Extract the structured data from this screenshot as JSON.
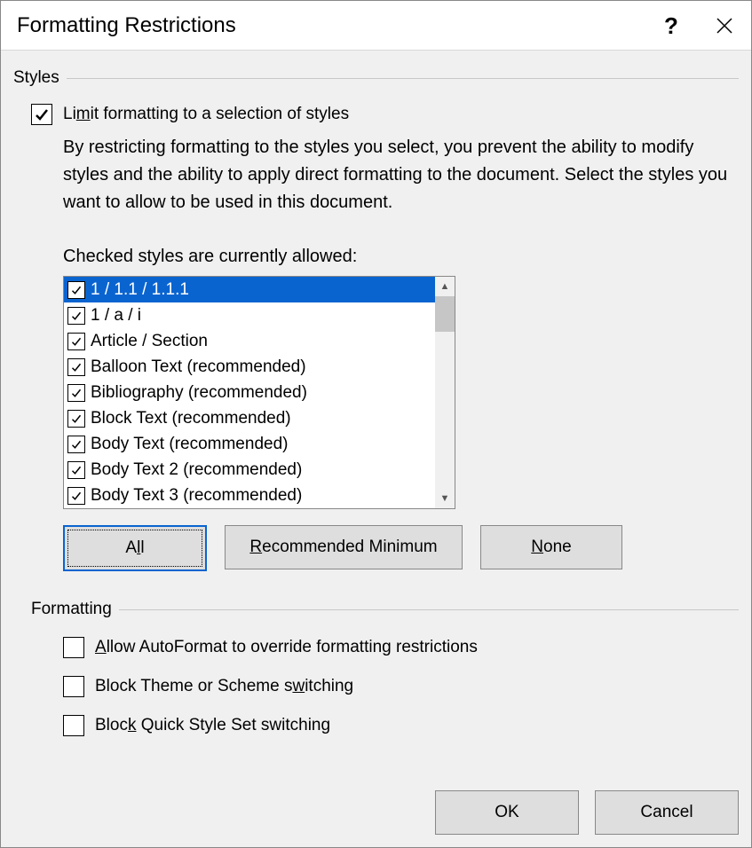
{
  "title": "Formatting Restrictions",
  "styles_section_label": "Styles",
  "limit_checkbox": {
    "label_pre": "Li",
    "label_u": "m",
    "label_post": "it formatting to a selection of styles",
    "checked": true
  },
  "description": "By restricting formatting to the styles you select, you prevent the ability to modify styles and the ability to apply direct formatting to the document. Select the styles you want to allow to be used in this document.",
  "list_header": "Checked styles are currently allowed:",
  "styles_list": [
    {
      "label": "1 / 1.1 / 1.1.1",
      "checked": true,
      "selected": true
    },
    {
      "label": "1 / a / i",
      "checked": true,
      "selected": false
    },
    {
      "label": "Article / Section",
      "checked": true,
      "selected": false
    },
    {
      "label": "Balloon Text (recommended)",
      "checked": true,
      "selected": false
    },
    {
      "label": "Bibliography (recommended)",
      "checked": true,
      "selected": false
    },
    {
      "label": "Block Text (recommended)",
      "checked": true,
      "selected": false
    },
    {
      "label": "Body Text (recommended)",
      "checked": true,
      "selected": false
    },
    {
      "label": "Body Text 2 (recommended)",
      "checked": true,
      "selected": false
    },
    {
      "label": "Body Text 3 (recommended)",
      "checked": true,
      "selected": false
    }
  ],
  "buttons": {
    "all_pre": "A",
    "all_u": "l",
    "all_post": "l",
    "rec_u": "R",
    "rec_post": "ecommended Minimum",
    "none_u": "N",
    "none_post": "one"
  },
  "formatting_section_label": "Formatting",
  "formatting_checks": [
    {
      "pre": "",
      "u": "A",
      "post": "llow AutoFormat to override formatting restrictions",
      "checked": false
    },
    {
      "pre": "Block Theme or Scheme s",
      "u": "w",
      "post": "itching",
      "checked": false
    },
    {
      "pre": "Bloc",
      "u": "k",
      "post": " Quick Style Set switching",
      "checked": false
    }
  ],
  "footer": {
    "ok": "OK",
    "cancel": "Cancel"
  }
}
